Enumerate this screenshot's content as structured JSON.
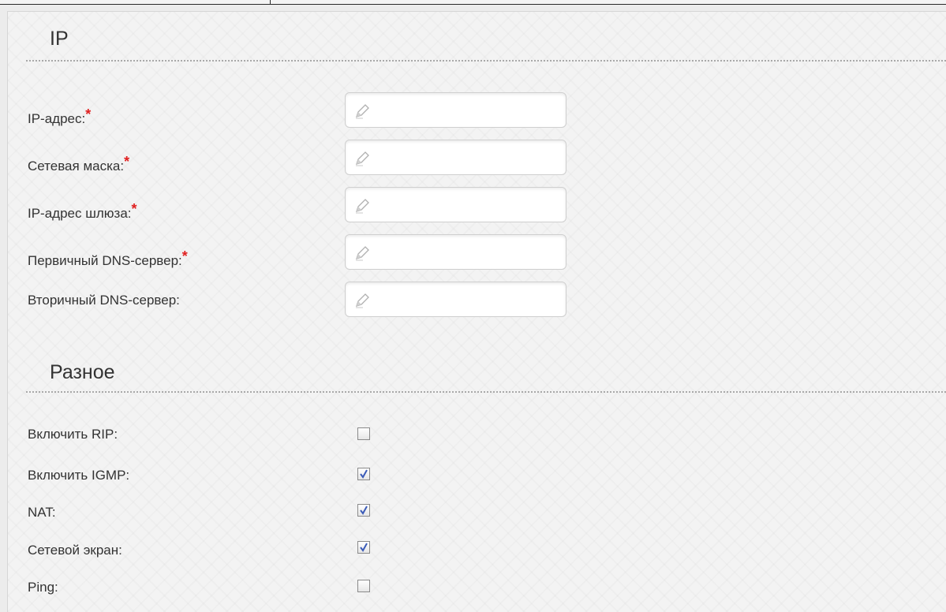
{
  "ip_section": {
    "title": "IP",
    "fields": [
      {
        "label": "IP-адрес:",
        "required_mark": "*",
        "value": ""
      },
      {
        "label": "Сетевая маска:",
        "required_mark": "*",
        "value": ""
      },
      {
        "label": "IP-адрес шлюза:",
        "required_mark": "*",
        "value": ""
      },
      {
        "label": "Первичный DNS-сервер:",
        "required_mark": "*",
        "value": ""
      },
      {
        "label": "Вторичный DNS-сервер:",
        "required_mark": "",
        "value": ""
      }
    ]
  },
  "misc_section": {
    "title": "Разное",
    "options": [
      {
        "label": "Включить RIP:",
        "checked": false
      },
      {
        "label": "Включить IGMP:",
        "checked": true
      },
      {
        "label": "NAT:",
        "checked": true
      },
      {
        "label": "Сетевой экран:",
        "checked": true
      },
      {
        "label": "Ping:",
        "checked": false
      }
    ]
  },
  "colors": {
    "required_mark": "#e02020",
    "checkmark": "#3b5bb8",
    "text": "#333333"
  },
  "icons": {
    "field_icon": "pencil-icon",
    "check_icon": "checkmark-icon"
  }
}
